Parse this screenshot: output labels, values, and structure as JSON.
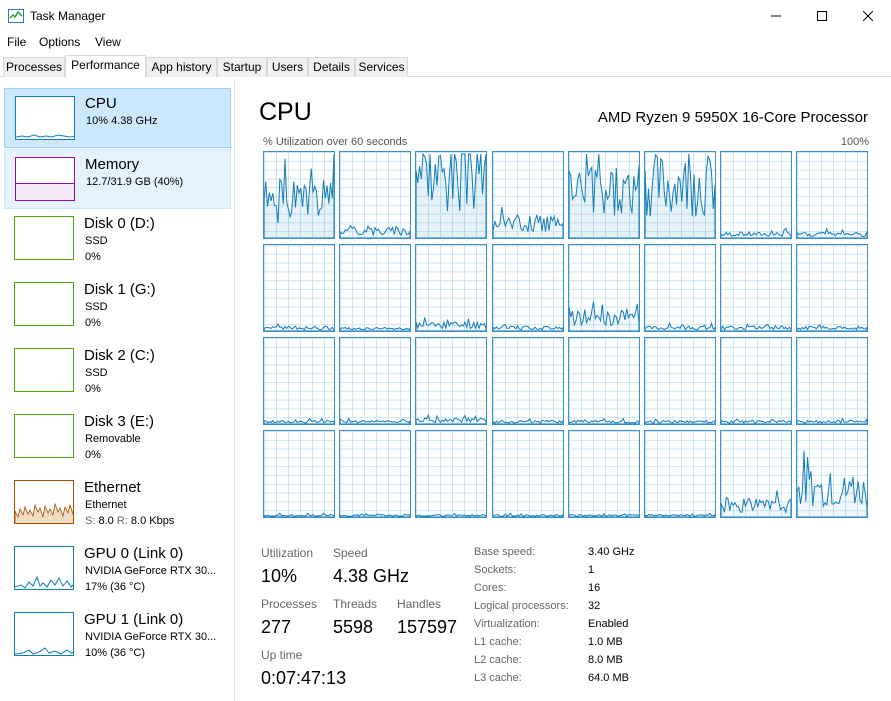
{
  "window": {
    "title": "Task Manager"
  },
  "menu": [
    "File",
    "Options",
    "View"
  ],
  "tabs": [
    "Processes",
    "Performance",
    "App history",
    "Startup",
    "Users",
    "Details",
    "Services"
  ],
  "active_tab": "Performance",
  "colors": {
    "cpu": "#117dbb",
    "memory": "#8b12ae",
    "disk": "#4da60c",
    "ethernet": "#a74f01",
    "gpu": "#0e7db5",
    "grid": "#cfe4f3",
    "selected_bg": "#cce8ff"
  },
  "sidebar": {
    "items": [
      {
        "title": "CPU",
        "line1": "10% 4.38 GHz",
        "line2": ""
      },
      {
        "title": "Memory",
        "line1": "12.7/31.9 GB (40%)",
        "line2": ""
      },
      {
        "title": "Disk 0 (D:)",
        "line1": "SSD",
        "line2": "0%"
      },
      {
        "title": "Disk 1 (G:)",
        "line1": "SSD",
        "line2": "0%"
      },
      {
        "title": "Disk 2 (C:)",
        "line1": "SSD",
        "line2": "0%"
      },
      {
        "title": "Disk 3 (E:)",
        "line1": "Removable",
        "line2": "0%"
      },
      {
        "title": "Ethernet",
        "line1": "Ethernet",
        "line2_s_label": "S:",
        "line2_s": "8.0",
        "line2_r_label": "R:",
        "line2_r": "8.0 Kbps"
      },
      {
        "title": "GPU 0 (Link 0)",
        "line1": "NVIDIA GeForce RTX 30...",
        "line2": "17% (36 °C)"
      },
      {
        "title": "GPU 1 (Link 0)",
        "line1": "NVIDIA GeForce RTX 30...",
        "line2": "10% (36 °C)"
      }
    ]
  },
  "main": {
    "title": "CPU",
    "cpu_model": "AMD Ryzen 9 5950X 16-Core Processor",
    "axis_caption": "% Utilization over 60 seconds",
    "axis_max": "100%",
    "cores_count": 32,
    "core_activity_pct": [
      48,
      10,
      85,
      20,
      60,
      70,
      5,
      5,
      4,
      3,
      8,
      4,
      18,
      4,
      4,
      4,
      3,
      3,
      5,
      3,
      3,
      3,
      3,
      3,
      2,
      2,
      2,
      2,
      2,
      2,
      15,
      35
    ],
    "stats": {
      "utilization_label": "Utilization",
      "utilization": "10%",
      "speed_label": "Speed",
      "speed": "4.38 GHz",
      "processes_label": "Processes",
      "processes": "277",
      "threads_label": "Threads",
      "threads": "5598",
      "handles_label": "Handles",
      "handles": "157597",
      "uptime_label": "Up time",
      "uptime": "0:07:47:13"
    },
    "details": [
      {
        "key": "Base speed:",
        "value": "3.40 GHz"
      },
      {
        "key": "Sockets:",
        "value": "1"
      },
      {
        "key": "Cores:",
        "value": "16"
      },
      {
        "key": "Logical processors:",
        "value": "32"
      },
      {
        "key": "Virtualization:",
        "value": "Enabled"
      },
      {
        "key": "L1 cache:",
        "value": "1.0 MB"
      },
      {
        "key": "L2 cache:",
        "value": "8.0 MB"
      },
      {
        "key": "L3 cache:",
        "value": "64.0 MB"
      }
    ]
  }
}
